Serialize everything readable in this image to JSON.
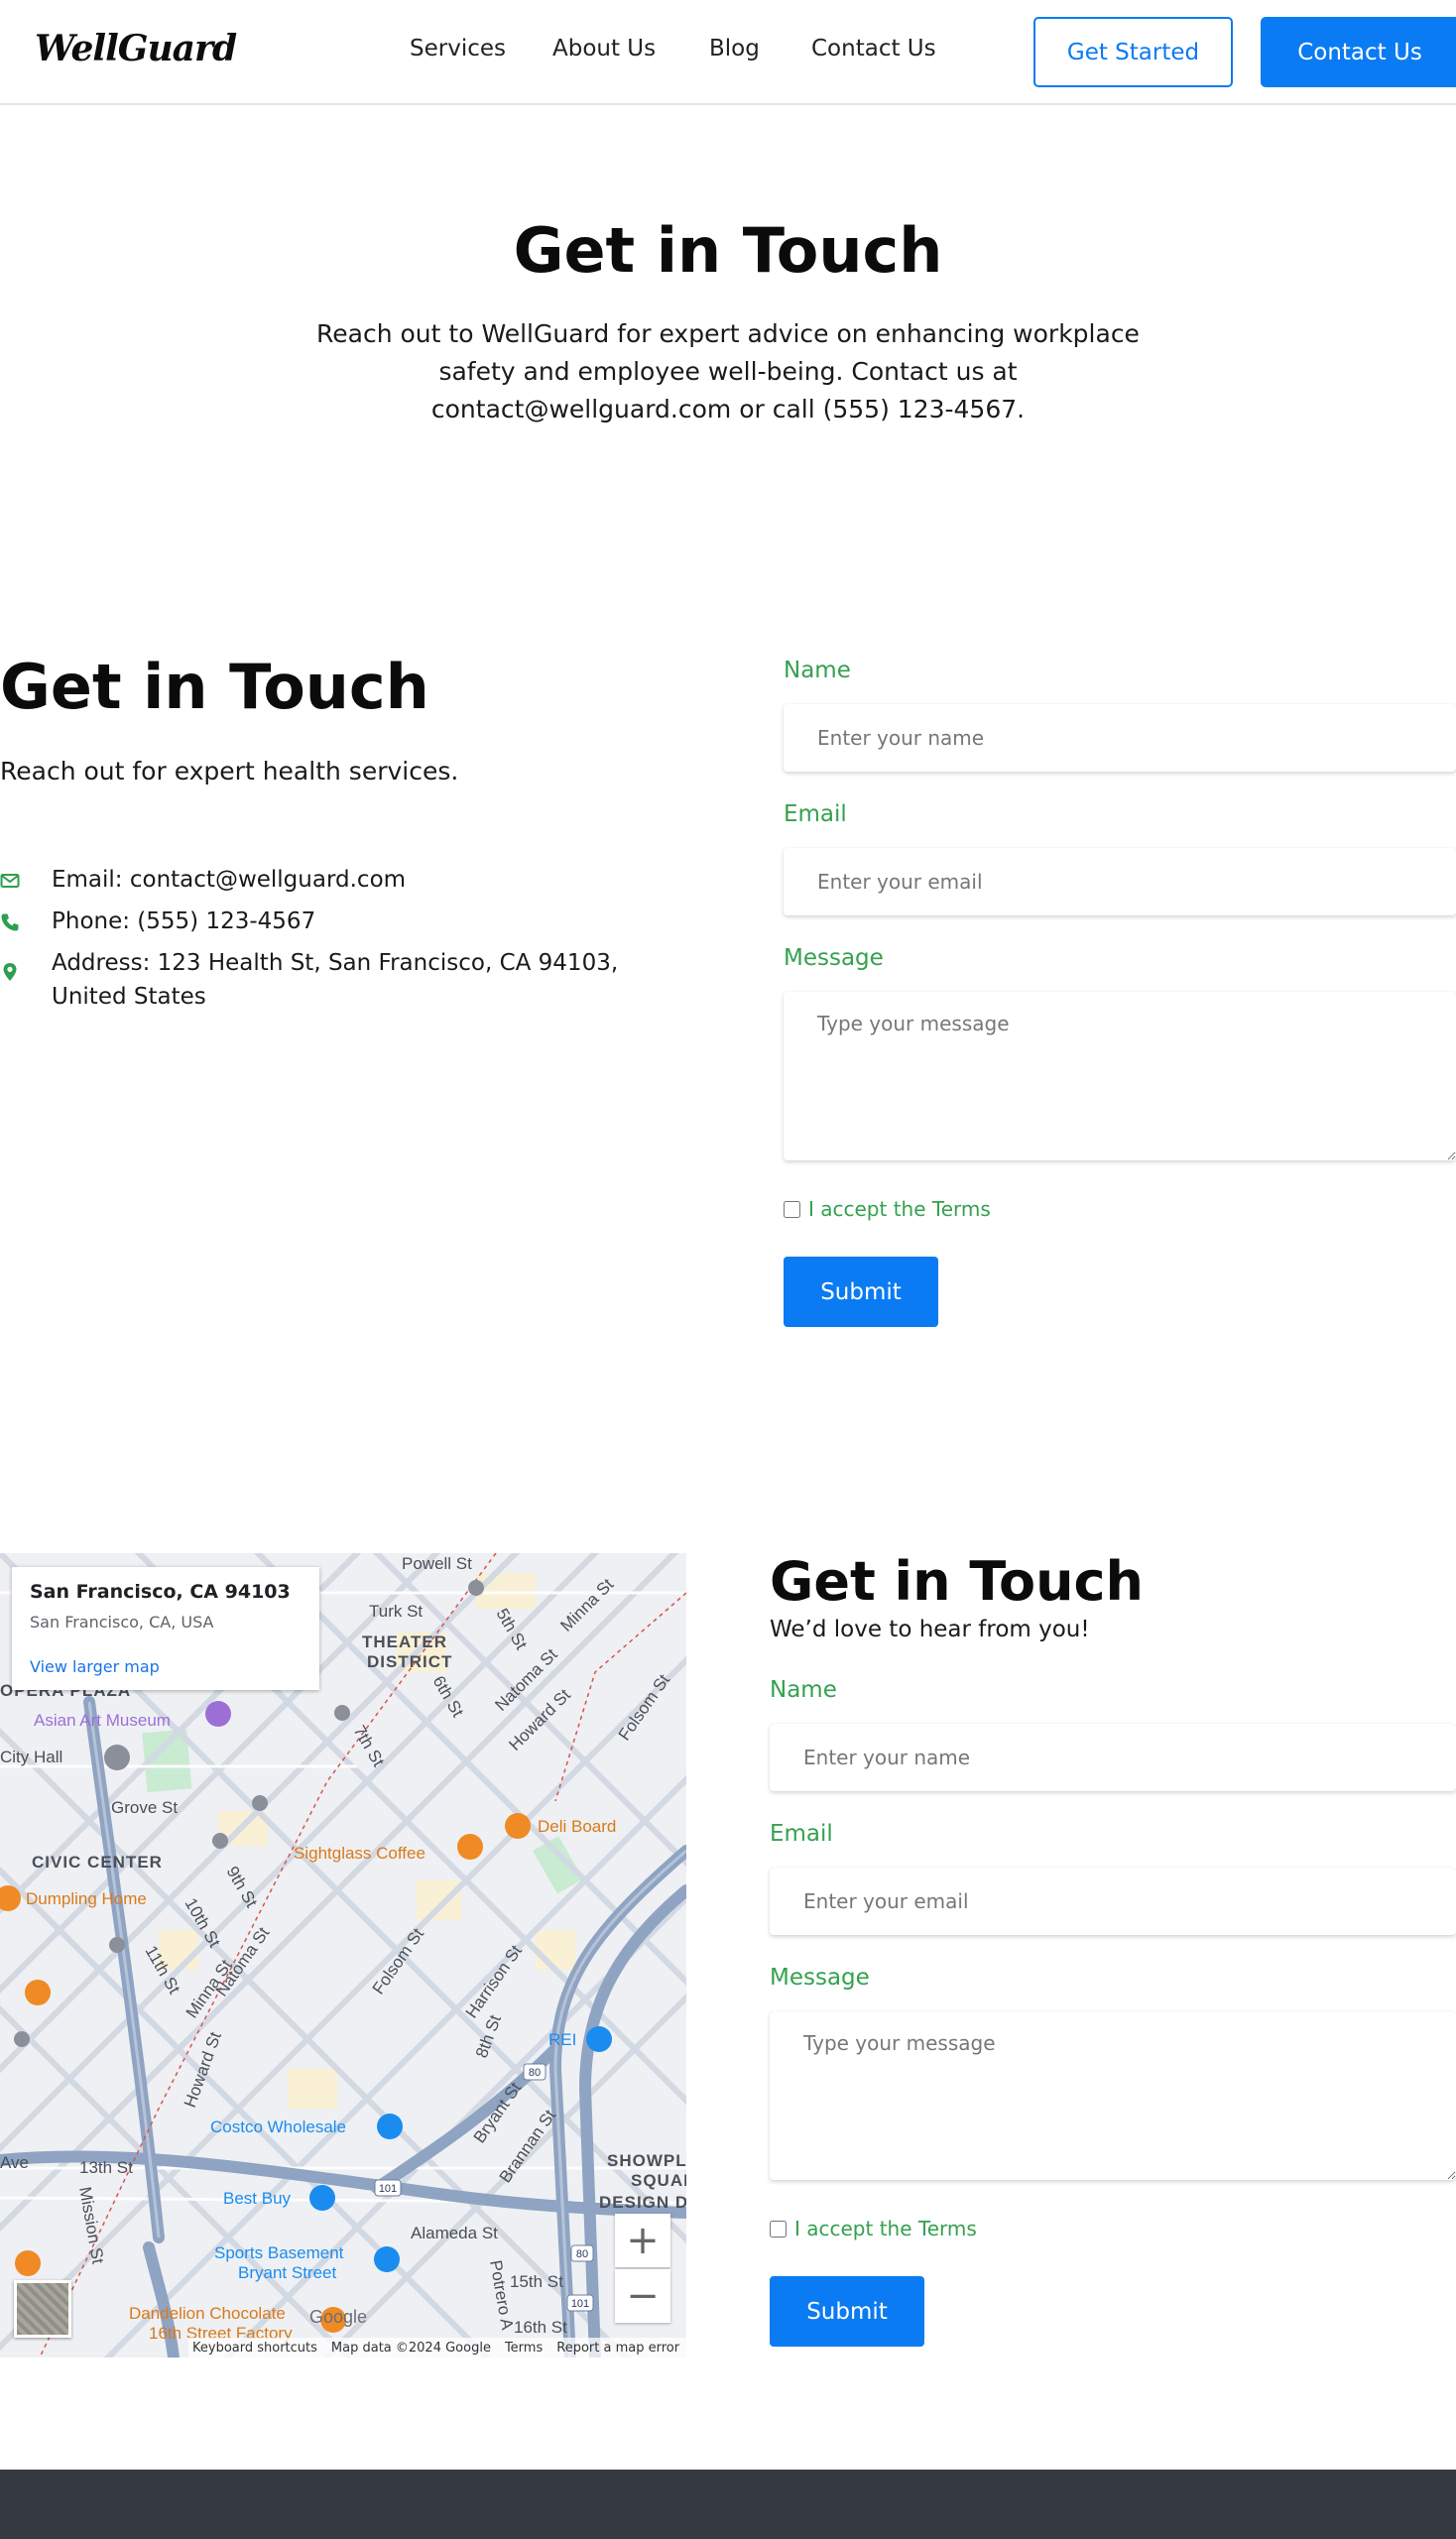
{
  "header": {
    "logo": "WellGuard",
    "nav": [
      "Services",
      "About Us",
      "Blog",
      "Contact Us"
    ],
    "get_started": "Get Started",
    "contact_us": "Contact Us"
  },
  "hero": {
    "title": "Get in Touch",
    "text": "Reach out to WellGuard for expert advice on enhancing workplace safety and employee well-being. Contact us at contact@wellguard.com or call (555) 123-4567."
  },
  "section2": {
    "title": "Get in Touch",
    "subtitle": "Reach out for expert health services.",
    "contact": {
      "email": "Email: contact@wellguard.com",
      "phone": "Phone: (555) 123-4567",
      "address": "Address: 123 Health St, San Francisco, CA 94103, United States"
    },
    "form": {
      "name_label": "Name",
      "name_placeholder": "Enter your name",
      "email_label": "Email",
      "email_placeholder": "Enter your email",
      "message_label": "Message",
      "message_placeholder": "Type your message",
      "terms": "I accept the Terms",
      "submit": "Submit"
    }
  },
  "map": {
    "place": "San Francisco, CA 94103",
    "region": "San Francisco, CA, USA",
    "link": "View larger map",
    "zoom_in": "+",
    "zoom_out": "−",
    "attribution": [
      "Keyboard shortcuts",
      "Map data ©2024 Google",
      "Terms",
      "Report a map error"
    ],
    "labels": [
      "Powell St",
      "Turk St",
      "5th St",
      "Minna St",
      "THEATER",
      "DISTRICT",
      "6th St",
      "Natoma St",
      "Howard St",
      "Folsom St",
      "OPERA PLAZA",
      "Asian Art Museum",
      "City Hall",
      "7th St",
      "Grove St",
      "Sightglass Coffee",
      "Deli Board",
      "CIVIC CENTER",
      "9th St",
      "Dumpling Home",
      "10th St",
      "11th St",
      "Minna St",
      "Natoma St",
      "Howard St",
      "Folsom St",
      "Harrison St",
      "8th St",
      "REI",
      "Costco Wholesale",
      "Bryant St",
      "Brannan St",
      "13th St",
      "Best Buy",
      "SHOWPLACE",
      "SQUARE",
      "DESIGN D",
      "Mission St",
      "Alameda St",
      "Sports Basement",
      "Bryant Street",
      "15th St",
      "Potrero A",
      "16th St",
      "Dandelion Chocolate",
      "16th Street Factory",
      "Ave",
      "Google"
    ]
  },
  "section3": {
    "title": "Get in Touch",
    "subtitle": "We’d love to hear from you!",
    "form": {
      "name_label": "Name",
      "name_placeholder": "Enter your name",
      "email_label": "Email",
      "email_placeholder": "Enter your email",
      "message_label": "Message",
      "message_placeholder": "Type your message",
      "terms": "I accept the Terms",
      "submit": "Submit"
    }
  }
}
